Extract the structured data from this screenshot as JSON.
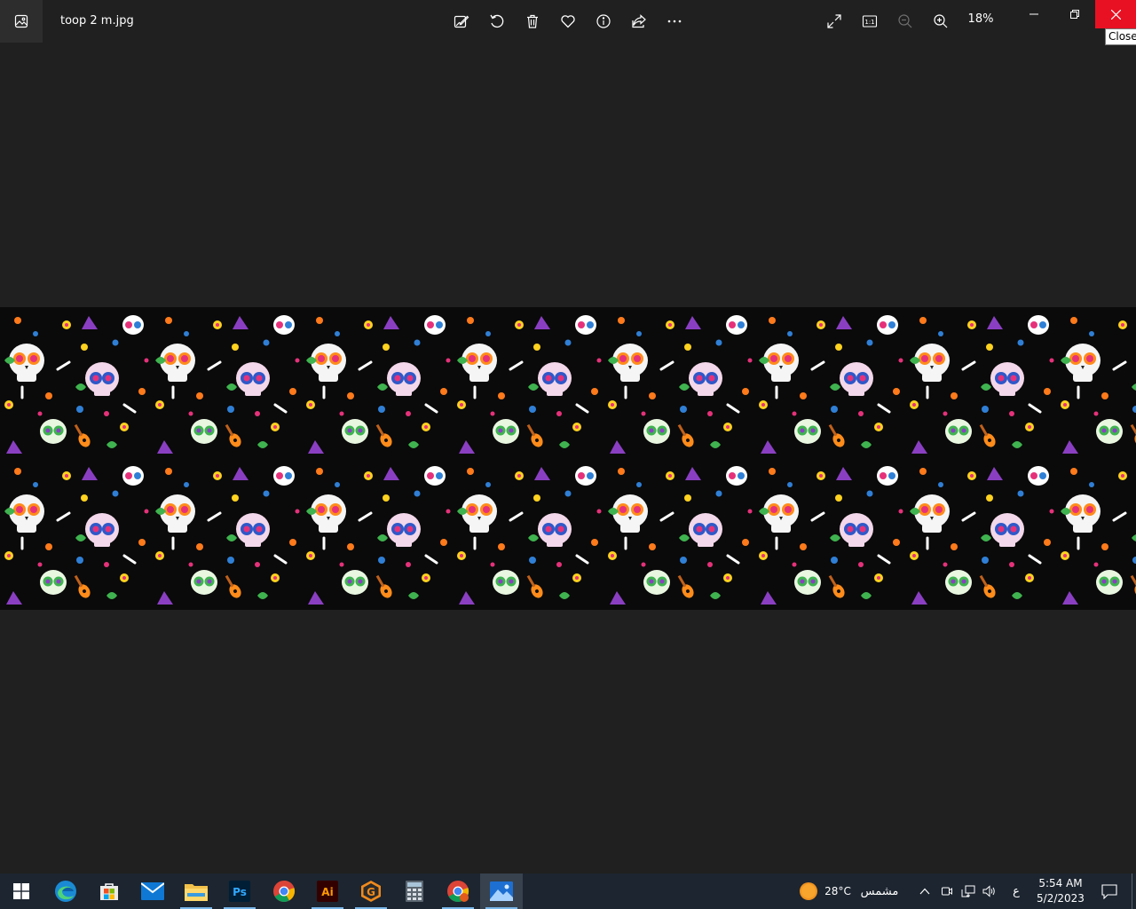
{
  "window": {
    "file_name": "toop 2 m.jpg",
    "zoom_level": "18%",
    "close_tooltip": "Close"
  },
  "toolbar": {
    "icons": [
      "edit-image-icon",
      "rotate-icon",
      "delete-icon",
      "favorite-icon",
      "info-icon",
      "share-icon",
      "more-icon"
    ],
    "view_icons": [
      "fullscreen-icon",
      "actual-size-icon",
      "zoom-out-icon",
      "zoom-in-icon"
    ],
    "actual_size_glyph": "1:1"
  },
  "image": {
    "description_colors": [
      "#000000",
      "#e6317a",
      "#ffd21f",
      "#2f7fd6",
      "#3fb34f",
      "#ff7a1a",
      "#8a3fc2",
      "#ffffff"
    ]
  },
  "taskbar": {
    "apps": [
      "start-icon",
      "edge-icon",
      "store-icon",
      "mail-icon",
      "file-explorer-icon",
      "photoshop-icon",
      "chrome-icon",
      "illustrator-icon",
      "g-app-icon",
      "calculator-icon",
      "chrome-profile-icon",
      "photos-icon"
    ],
    "photoshop_glyph": "Ps",
    "illustrator_glyph": "Ai",
    "g_glyph": "G",
    "weather_temp": "28°C",
    "weather_text": "مشمس",
    "language": "ع",
    "time": "5:54 AM",
    "date": "5/2/2023"
  }
}
